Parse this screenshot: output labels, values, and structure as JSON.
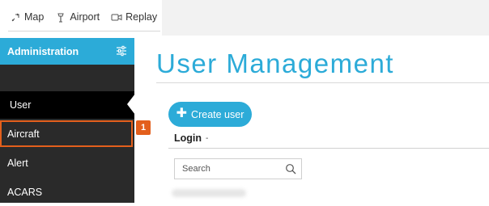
{
  "topnav": {
    "items": [
      {
        "label": "Map",
        "icon": "map-pin-icon"
      },
      {
        "label": "Airport",
        "icon": "airport-icon"
      },
      {
        "label": "Replay",
        "icon": "video-camera-icon"
      }
    ]
  },
  "sidebar": {
    "header": {
      "title": "Administration",
      "icon": "sliders-icon"
    },
    "items": [
      {
        "label": "User",
        "state": "active"
      },
      {
        "label": "Aircraft",
        "state": "highlighted"
      },
      {
        "label": "Alert",
        "state": "normal"
      },
      {
        "label": "ACARS",
        "state": "normal"
      }
    ]
  },
  "step_badge": "1",
  "main": {
    "title": "User Management",
    "create_button": {
      "label": "Create user",
      "icon": "plus-icon"
    },
    "table": {
      "column_header": "Login",
      "sort_indicator": "-"
    },
    "search": {
      "placeholder": "Search",
      "icon": "search-icon"
    }
  },
  "colors": {
    "accent": "#2cabd8",
    "sidebar_bg": "#2a2a2a",
    "active_item_bg": "#000000",
    "highlight": "#e35f1c"
  }
}
